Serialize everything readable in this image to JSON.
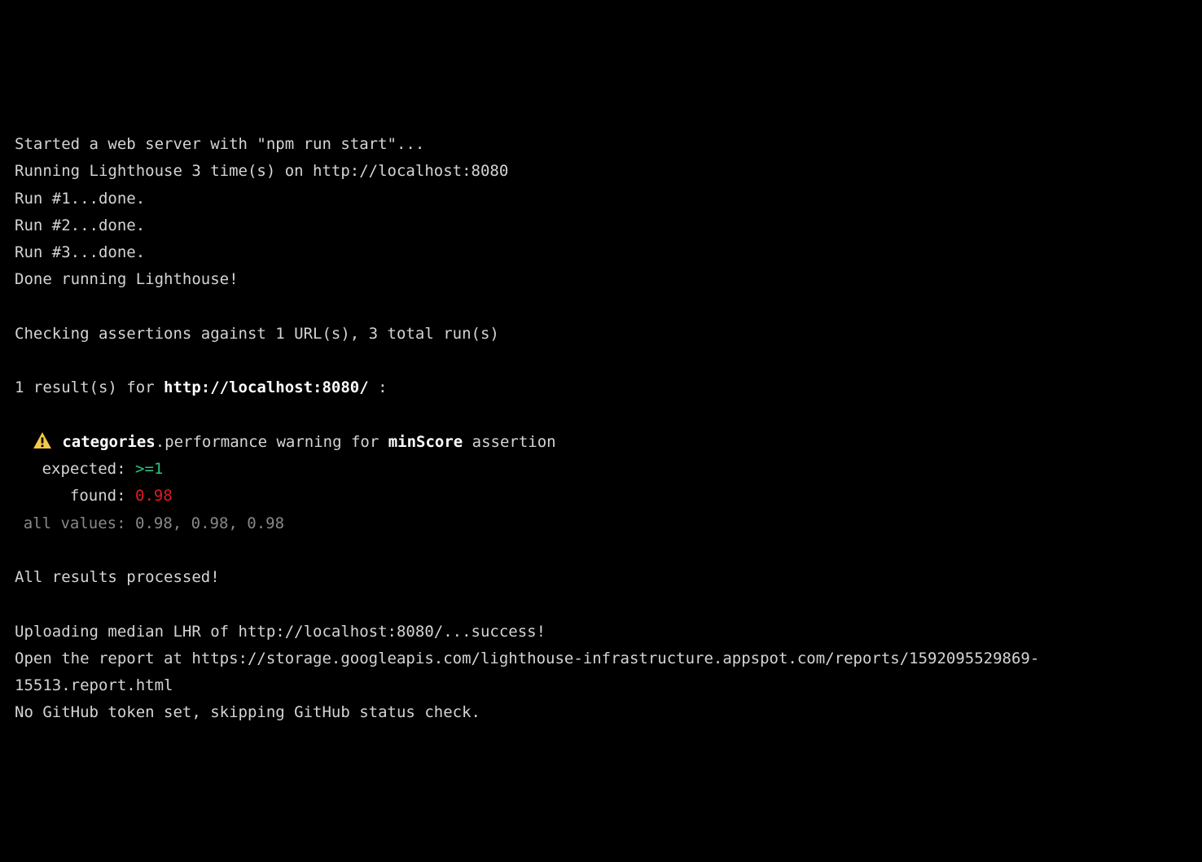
{
  "log": {
    "started": "Started a web server with \"npm run start\"...",
    "running": "Running Lighthouse 3 time(s) on http://localhost:8080",
    "run1": "Run #1...done.",
    "run2": "Run #2...done.",
    "run3": "Run #3...done.",
    "doneRunning": "Done running Lighthouse!",
    "checking": "Checking assertions against 1 URL(s), 3 total run(s)",
    "resultsPrefix": "1 result(s) for ",
    "resultsUrl": "http://localhost:8080/",
    "resultsSuffix": " :"
  },
  "assertion": {
    "category": "categories",
    "metric": ".performance warning for ",
    "assertionName": "minScore",
    "assertionSuffix": " assertion",
    "expectedLabel": "expected: ",
    "expectedOp": ">=",
    "expectedVal": "1",
    "foundLabel": "found: ",
    "foundVal": "0.98",
    "allValuesLabel": "all values: ",
    "allValuesVal": "0.98, 0.98, 0.98"
  },
  "footer": {
    "processed": "All results processed!",
    "uploading": "Uploading median LHR of http://localhost:8080/...success!",
    "openReport": "Open the report at https://storage.googleapis.com/lighthouse-infrastructure.appspot.com/reports/1592095529869-15513.report.html",
    "noToken": "No GitHub token set, skipping GitHub status check."
  }
}
